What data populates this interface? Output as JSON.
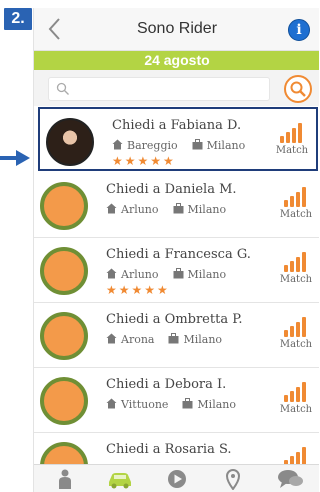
{
  "step": {
    "label": "2."
  },
  "header": {
    "title": "Sono Rider",
    "back_icon": "chevron-left-icon",
    "info_icon": "info-icon",
    "info_glyph": "i"
  },
  "date_bar": {
    "label": "24 agosto"
  },
  "search": {
    "placeholder": "",
    "value": "",
    "icon": "search-icon"
  },
  "riders": [
    {
      "name": "Chiedi a Fabiana D.",
      "from": "Bareggio",
      "to": "Milano",
      "stars": "★★★★★",
      "match": "Match",
      "avatar": "photo",
      "selected": true
    },
    {
      "name": "Chiedi a Daniela M.",
      "from": "Arluno",
      "to": "Milano",
      "stars": "",
      "match": "Match",
      "avatar": "placeholder",
      "selected": false
    },
    {
      "name": "Chiedi a Francesca G.",
      "from": "Arluno",
      "to": "Milano",
      "stars": "★★★★★",
      "match": "Match",
      "avatar": "placeholder",
      "selected": false
    },
    {
      "name": "Chiedi a Ombretta P.",
      "from": "Arona",
      "to": "Milano",
      "stars": "",
      "match": "Match",
      "avatar": "placeholder",
      "selected": false
    },
    {
      "name": "Chiedi a Debora I.",
      "from": "Vittuone",
      "to": "Milano",
      "stars": "",
      "match": "Match",
      "avatar": "placeholder",
      "selected": false
    },
    {
      "name": "Chiedi a Rosaria S.",
      "from": "",
      "to": "",
      "stars": "",
      "match": "",
      "avatar": "placeholder",
      "selected": false
    }
  ],
  "tabs": [
    {
      "icon": "person-icon"
    },
    {
      "icon": "car-icon"
    },
    {
      "icon": "play-icon"
    },
    {
      "icon": "map-pin-icon"
    },
    {
      "icon": "chat-icon"
    }
  ],
  "colors": {
    "accent_green": "#b3d444",
    "accent_orange": "#f08a33",
    "info_blue": "#1e6fd1",
    "selection_border": "#1f3d7a",
    "step_badge": "#2a63b3"
  }
}
